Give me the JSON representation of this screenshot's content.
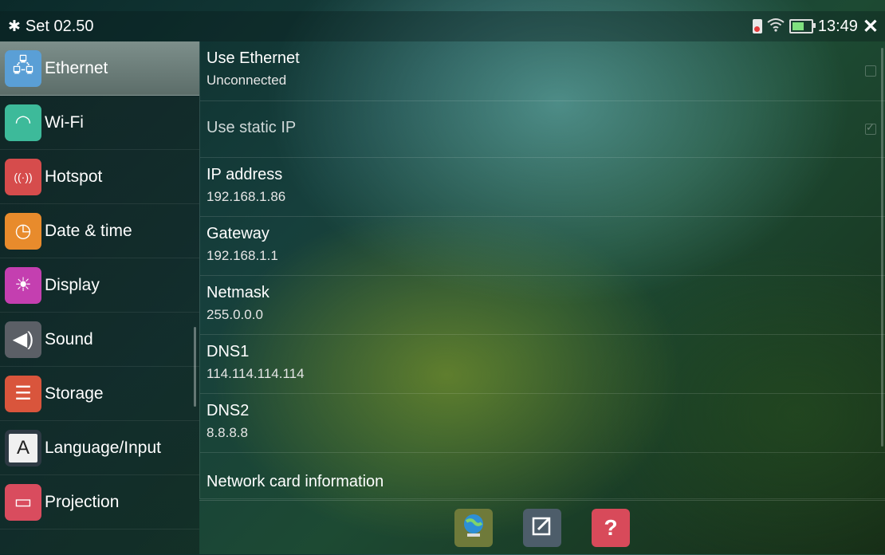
{
  "statusbar": {
    "title": "Set 02.50",
    "time": "13:49",
    "battery_level": 0.7,
    "icons": [
      "gear-icon",
      "sd-card-icon",
      "wifi-icon",
      "battery-icon",
      "close-icon"
    ]
  },
  "sidebar": {
    "items": [
      {
        "label": "Ethernet",
        "icon": "ethernet-icon",
        "color": "#5a9fd6",
        "active": true
      },
      {
        "label": "Wi-Fi",
        "icon": "wifi-icon",
        "color": "#3dba9a"
      },
      {
        "label": "Hotspot",
        "icon": "hotspot-icon",
        "color": "#d64c4c"
      },
      {
        "label": "Date & time",
        "icon": "clock-icon",
        "color": "#e88b2c"
      },
      {
        "label": "Display",
        "icon": "brightness-icon",
        "color": "#c43fb0"
      },
      {
        "label": "Sound",
        "icon": "speaker-icon",
        "color": "#5b5f66"
      },
      {
        "label": "Storage",
        "icon": "storage-icon",
        "color": "#d9553c"
      },
      {
        "label": "Language/Input",
        "icon": "keyboard-icon",
        "color": "#2e3a44"
      },
      {
        "label": "Projection",
        "icon": "projection-icon",
        "color": "#d94c5e"
      }
    ]
  },
  "content": {
    "rows": [
      {
        "title": "Use Ethernet",
        "subtitle": "Unconnected",
        "checkbox": true,
        "checked": false
      },
      {
        "title": "Use static IP",
        "subtitle": "",
        "checkbox": true,
        "checked": true,
        "dim": true
      },
      {
        "title": "IP address",
        "subtitle": "192.168.1.86"
      },
      {
        "title": "Gateway",
        "subtitle": "192.168.1.1"
      },
      {
        "title": "Netmask",
        "subtitle": "255.0.0.0"
      },
      {
        "title": "DNS1",
        "subtitle": "114.114.114.114"
      },
      {
        "title": "DNS2",
        "subtitle": "8.8.8.8"
      },
      {
        "title": "Network card information",
        "subtitle": ""
      }
    ]
  },
  "bottombar": {
    "buttons": [
      {
        "icon": "globe-icon",
        "color": "#6f7a3a"
      },
      {
        "icon": "edit-icon",
        "color": "#4d5d6a"
      },
      {
        "icon": "help-icon",
        "label": "?",
        "color": "#d84a5a"
      }
    ]
  }
}
